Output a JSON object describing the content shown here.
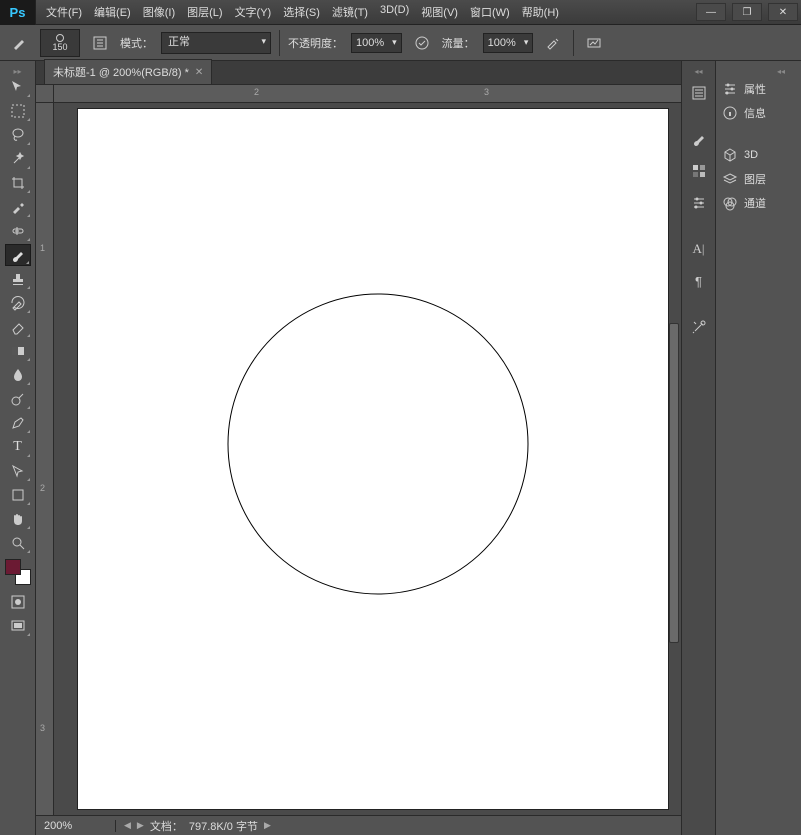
{
  "app": {
    "logo": "Ps"
  },
  "menu": [
    "文件(F)",
    "编辑(E)",
    "图像(I)",
    "图层(L)",
    "文字(Y)",
    "选择(S)",
    "滤镜(T)",
    "3D(D)",
    "视图(V)",
    "窗口(W)",
    "帮助(H)"
  ],
  "window_controls": {
    "minimize": "—",
    "restore": "❐",
    "close": "✕"
  },
  "options": {
    "brush_size": "150",
    "mode_label": "模式：",
    "mode_value": "正常",
    "opacity_label": "不透明度：",
    "opacity_value": "100%",
    "flow_label": "流量：",
    "flow_value": "100%"
  },
  "document": {
    "tab_title": "未标题-1 @ 200%(RGB/8) *",
    "zoom": "200%",
    "status_label": "文档：",
    "status_value": "797.8K/0 字节"
  },
  "ruler_h": [
    "2",
    "3"
  ],
  "ruler_v": [
    "1",
    "2",
    "3"
  ],
  "right_panels": [
    {
      "icon": "sliders",
      "label": "属性"
    },
    {
      "icon": "info",
      "label": "信息"
    },
    {
      "icon": "cube",
      "label": "3D"
    },
    {
      "icon": "layers",
      "label": "图层"
    },
    {
      "icon": "channels",
      "label": "通道"
    }
  ],
  "colors": {
    "foreground": "#6b1a33",
    "background": "#ffffff"
  }
}
